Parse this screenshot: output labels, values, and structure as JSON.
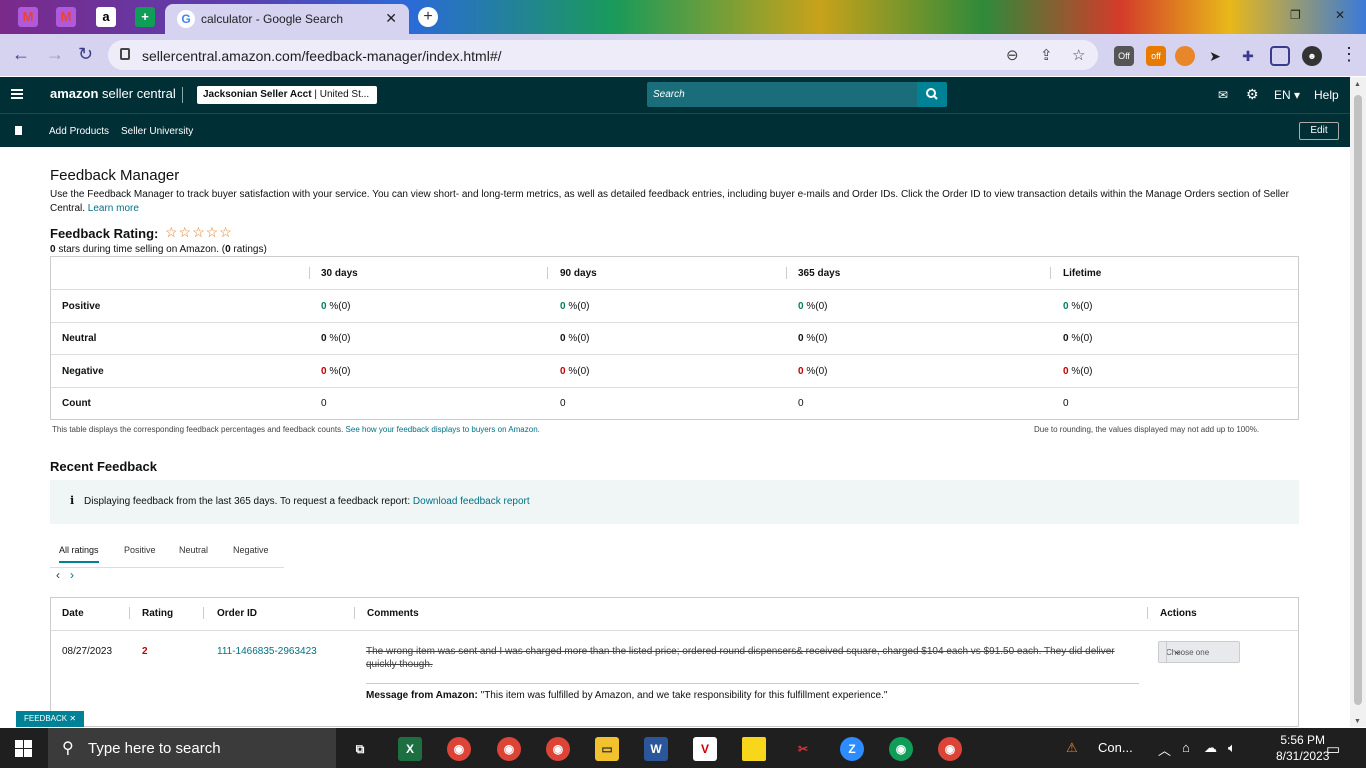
{
  "browser": {
    "tab_title": "calculator - Google Search",
    "tab_close": "✕",
    "url": "sellercentral.amazon.com/feedback-manager/index.html#/",
    "extensions": [
      "Off",
      "off"
    ]
  },
  "header": {
    "logo_brand": "amazon",
    "logo_rest": " seller central",
    "account_name": "Jacksonian Seller Acct",
    "account_region": " | United St...",
    "search_placeholder": "Search",
    "language": "EN",
    "help": "Help"
  },
  "nav": {
    "links": [
      "Add Products",
      "Seller University"
    ],
    "edit": "Edit"
  },
  "page": {
    "title": "Feedback Manager",
    "description": "Use the Feedback Manager to track buyer satisfaction with your service. You can view short- and long-term metrics, as well as detailed feedback entries, including buyer e-mails and Order IDs. Click the Order ID to view transaction details within the Manage Orders section of Seller Central.",
    "learn_more": "Learn more",
    "rating_heading": "Feedback Rating:",
    "stars": "☆☆☆☆☆",
    "rating_stars_value": "0",
    "rating_sub_text": " stars during time selling on Amazon. (",
    "rating_count": "0",
    "rating_sub_end": " ratings)"
  },
  "metrics": {
    "columns": [
      "30 days",
      "90 days",
      "365 days",
      "Lifetime"
    ],
    "rows": [
      {
        "label": "Positive",
        "values": [
          "0",
          "0",
          "0",
          "0"
        ],
        "suffix": " %(0)"
      },
      {
        "label": "Neutral",
        "values": [
          "0",
          "0",
          "0",
          "0"
        ],
        "suffix": " %(0)"
      },
      {
        "label": "Negative",
        "values": [
          "0",
          "0",
          "0",
          "0"
        ],
        "suffix": " %(0)"
      },
      {
        "label": "Count",
        "values": [
          "0",
          "0",
          "0",
          "0"
        ],
        "suffix": ""
      }
    ],
    "footnote_left": "This table displays the corresponding feedback percentages and feedback counts.",
    "footnote_link": "See how your feedback displays to buyers on Amazon.",
    "footnote_right": "Due to rounding, the values displayed may not add up to 100%."
  },
  "recent": {
    "heading": "Recent Feedback",
    "info_icon": "i",
    "info_text": "Displaying feedback from the last 365 days. To request a feedback report:",
    "info_link": "Download feedback report",
    "tabs": [
      "All ratings",
      "Positive",
      "Neutral",
      "Negative"
    ],
    "pager_prev": "‹",
    "pager_next": "›",
    "columns": [
      "Date",
      "Rating",
      "Order ID",
      "Comments",
      "Actions"
    ],
    "rows": [
      {
        "date": "08/27/2023",
        "rating": "2",
        "order_id": "111-1466835-2963423",
        "comment": "The wrong item was sent and I was charged more than the listed price; ordered round dispensers& received square, charged $104 each vs $91.50 each. They did deliver quickly though.",
        "message_label": "Message from Amazon:",
        "message": " \"This item was fulfilled by Amazon, and we take responsibility for this fulfillment experience.\"",
        "action": "Choose one"
      }
    ]
  },
  "feedback_tag": "FEEDBACK ✕",
  "taskbar": {
    "search_placeholder": "Type here to search",
    "tray_app": "Con...",
    "time": "5:56 PM",
    "date": "8/31/2023"
  },
  "colors": {
    "header_bg": "#002f36",
    "search_bg": "#1a6e7a",
    "link": "#007185",
    "positive": "#067d62",
    "negative": "#c40000",
    "taskbar": "#1f1f1f"
  }
}
